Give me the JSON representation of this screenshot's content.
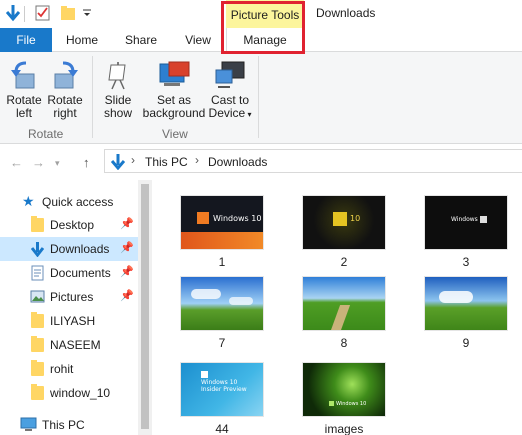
{
  "window": {
    "title": "Downloads",
    "contextual_tab_group": "Picture Tools"
  },
  "ribbon_tabs": {
    "file": "File",
    "home": "Home",
    "share": "Share",
    "view": "View",
    "manage": "Manage"
  },
  "ribbon": {
    "rotate_left_line1": "Rotate",
    "rotate_left_line2": "left",
    "rotate_right_line1": "Rotate",
    "rotate_right_line2": "right",
    "rotate_group": "Rotate",
    "slideshow_line1": "Slide",
    "slideshow_line2": "show",
    "set_bg_line1": "Set as",
    "set_bg_line2": "background",
    "cast_line1": "Cast to",
    "cast_line2": "Device",
    "view_group": "View"
  },
  "address": {
    "crumbs": [
      "This PC",
      "Downloads"
    ]
  },
  "nav": {
    "quick_access": "Quick access",
    "items": [
      {
        "label": "Desktop",
        "pinned": true
      },
      {
        "label": "Downloads",
        "pinned": true
      },
      {
        "label": "Documents",
        "pinned": true
      },
      {
        "label": "Pictures",
        "pinned": true
      },
      {
        "label": "ILIYASH",
        "pinned": false
      },
      {
        "label": "NASEEM",
        "pinned": false
      },
      {
        "label": "rohit",
        "pinned": false
      },
      {
        "label": "window_10",
        "pinned": false
      }
    ],
    "this_pc": "This PC"
  },
  "files": [
    {
      "name": "1",
      "thumb_text": "Windows 10"
    },
    {
      "name": "2",
      "thumb_text": "10"
    },
    {
      "name": "3",
      "thumb_text": "Windows"
    },
    {
      "name": "7",
      "thumb_text": ""
    },
    {
      "name": "8",
      "thumb_text": ""
    },
    {
      "name": "9",
      "thumb_text": ""
    },
    {
      "name": "44",
      "thumb_text": "Windows 10 Insider Preview"
    },
    {
      "name": "images",
      "thumb_text": "Windows 10"
    }
  ],
  "colors": {
    "file_tab": "#1979ca",
    "picture_tools": "#fcf59c",
    "highlight": "#e02230",
    "selected_nav": "#cce8ff"
  }
}
